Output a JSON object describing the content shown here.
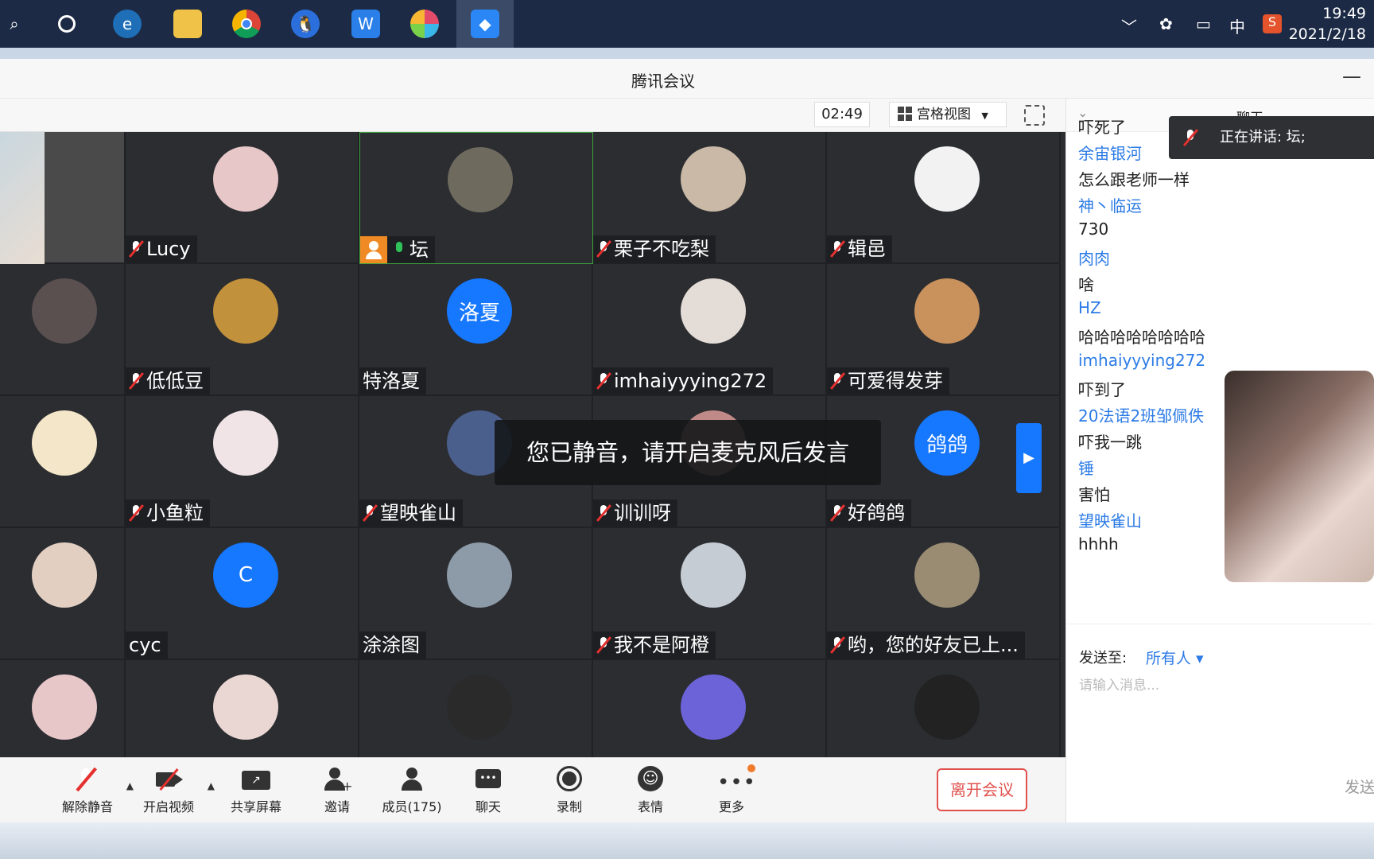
{
  "taskbar": {
    "icons": [
      "search-icon",
      "cortana-icon",
      "browser-icon",
      "file-explorer-icon",
      "chrome-icon",
      "qq-icon",
      "wps-icon",
      "app-icon",
      "tencent-meeting-icon"
    ],
    "tray": {
      "ime": "中"
    },
    "clock": {
      "time": "19:49",
      "date": "2021/2/18"
    }
  },
  "window": {
    "title": "腾讯会议",
    "minimize": "—"
  },
  "toolbar": {
    "timer": "02:49",
    "view_label": "宫格视图",
    "view_caret": "▼"
  },
  "participants": [
    {
      "name": "Lucy",
      "mic": "off",
      "avatar_color": "#e8c7c9"
    },
    {
      "name": "坛",
      "mic": "on",
      "host": true,
      "avatar_color": "#6f6a5e",
      "selected": true
    },
    {
      "name": "栗子不吃梨",
      "mic": "off",
      "avatar_color": "#c9b9a6"
    },
    {
      "name": "辑邑",
      "mic": "off",
      "avatar_color": "#f2f2f2"
    },
    {
      "name": "低低豆",
      "mic": "off",
      "avatar_color": "#c2913b"
    },
    {
      "name": "特洛夏",
      "mic": "none",
      "avatar_text": "洛夏",
      "avatar_color": "#1677ff"
    },
    {
      "name": "imhaiyyying272",
      "mic": "off",
      "avatar_color": "#e4dcd6"
    },
    {
      "name": "可爱得发芽",
      "mic": "off",
      "avatar_color": "#c9915c"
    },
    {
      "name": "小鱼粒",
      "mic": "off",
      "avatar_color": "#f0e4e6"
    },
    {
      "name": "望映雀山",
      "mic": "off",
      "avatar_color": "#4b5f8d"
    },
    {
      "name": "训训呀",
      "mic": "off",
      "avatar_color": "#c08a88"
    },
    {
      "name": "好鸽鸽",
      "mic": "off",
      "avatar_text": "鸽鸽",
      "avatar_color": "#1677ff"
    },
    {
      "name": "cyc",
      "mic": "none",
      "avatar_text": "C",
      "avatar_color": "#1677ff"
    },
    {
      "name": "涂涂图",
      "mic": "none",
      "avatar_color": "#8d9aa8"
    },
    {
      "name": "我不是阿橙",
      "mic": "off",
      "avatar_color": "#c6ccd4"
    },
    {
      "name": "哟，您的好友已上...",
      "mic": "off",
      "avatar_color": "#9a8c73"
    },
    {
      "name": "",
      "mic": "none",
      "avatar_color": "#ead7d3"
    },
    {
      "name": "",
      "mic": "none",
      "avatar_color": "#2a2a2a"
    },
    {
      "name": "",
      "mic": "none",
      "avatar_color": "#6d63d9"
    },
    {
      "name": "",
      "mic": "none",
      "avatar_color": "#222222"
    }
  ],
  "toast": "您已静音，请开启麦克风后发言",
  "next_page": "▶",
  "bottom": {
    "mute": "解除静音",
    "video": "开启视频",
    "share": "共享屏幕",
    "invite": "邀请",
    "members": "成员(175)",
    "chat": "聊天",
    "record": "录制",
    "emoji": "表情",
    "more": "更多",
    "leave": "离开会议"
  },
  "chat": {
    "title": "聊天",
    "speaking": "正在讲话: 坛;",
    "messages": [
      {
        "text": "吓死了",
        "sender": false
      },
      {
        "text": "余宙银河",
        "sender": true
      },
      {
        "text": "怎么跟老师一样",
        "sender": false
      },
      {
        "text": "神丶临运",
        "sender": true
      },
      {
        "text": "730",
        "sender": false
      },
      {
        "text": "肉肉",
        "sender": true
      },
      {
        "text": "啥",
        "sender": false
      },
      {
        "text": "HZ",
        "sender": true
      },
      {
        "text": "哈哈哈哈哈哈哈哈",
        "sender": false
      },
      {
        "text": "imhaiyyying272",
        "sender": true
      },
      {
        "text": "吓到了",
        "sender": false
      },
      {
        "text": "20法语2班邹佩佚",
        "sender": true
      },
      {
        "text": "吓我一跳",
        "sender": false
      },
      {
        "text": "锤",
        "sender": true
      },
      {
        "text": "害怕",
        "sender": false
      },
      {
        "text": "望映雀山",
        "sender": true
      },
      {
        "text": "hhhh",
        "sender": false
      }
    ],
    "send_to_label": "发送至:",
    "send_to_value": "所有人 ▾",
    "input_placeholder": "请输入消息...",
    "send": "发送"
  },
  "colors": {
    "accent": "#1677ff",
    "leave": "#e0524e",
    "grid_bg": "#2b2d31"
  }
}
